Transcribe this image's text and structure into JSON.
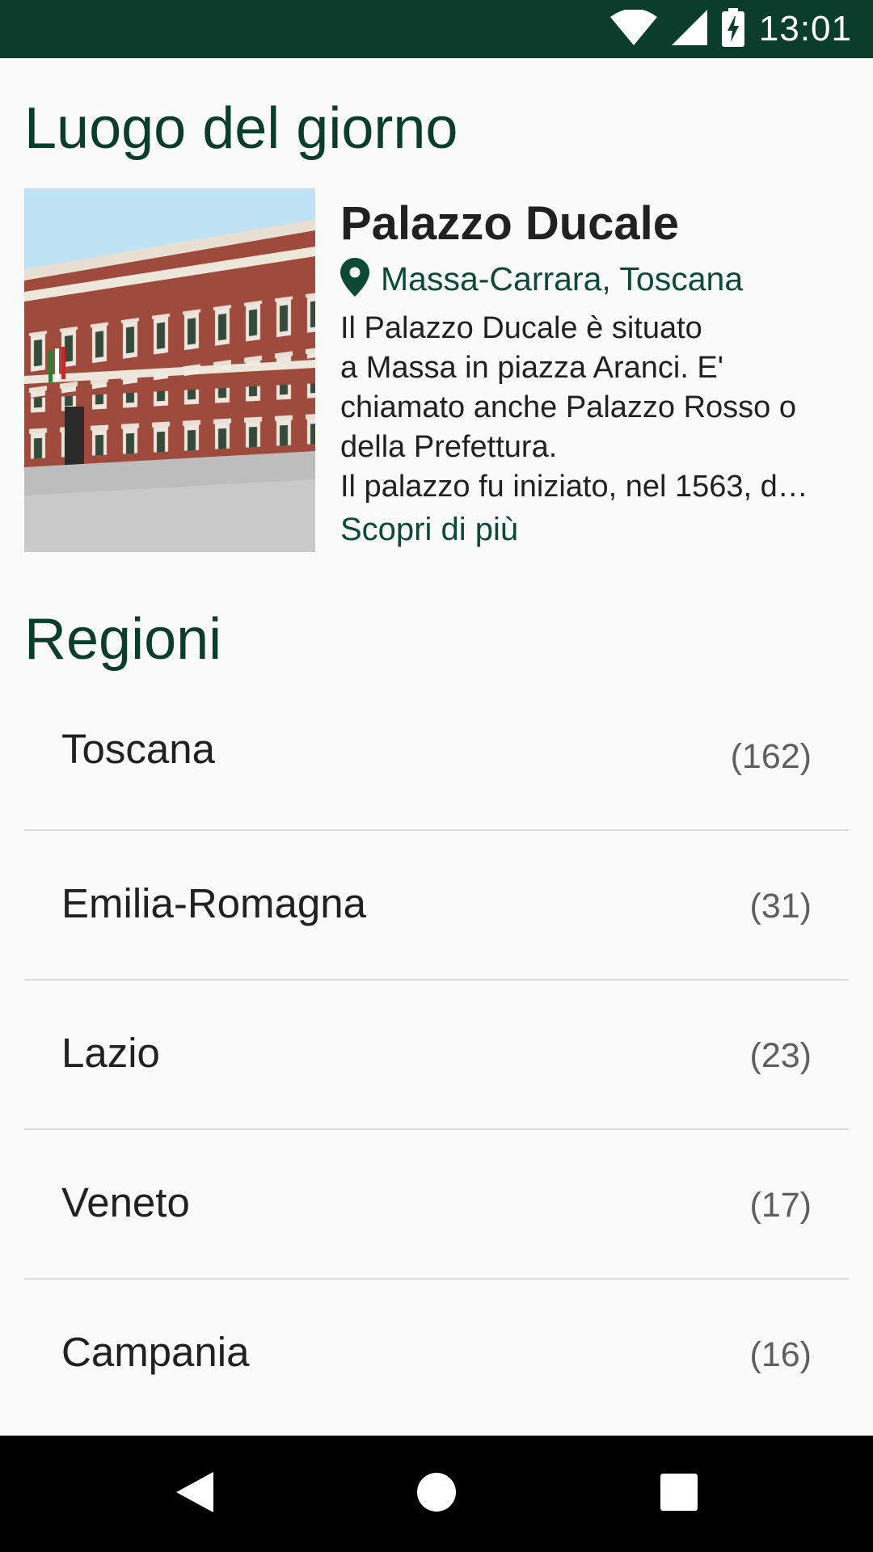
{
  "status_bar": {
    "time": "13:01",
    "icons": [
      "wifi-icon",
      "cell-signal-icon",
      "battery-charging-icon"
    ]
  },
  "place_of_day": {
    "section_title": "Luogo del giorno",
    "name": "Palazzo Ducale",
    "location_icon": "map-pin-icon",
    "location": "Massa-Carrara, Toscana",
    "description_lines": [
      "Il Palazzo Ducale è situato",
      "a Massa in piazza Aranci. E'",
      "chiamato anche Palazzo Rosso o",
      "della Prefettura.",
      "Il palazzo fu iniziato, nel 1563, d…"
    ],
    "more_link": "Scopri di più"
  },
  "regions": {
    "section_title": "Regioni",
    "items": [
      {
        "name": "Toscana",
        "count": "(162)"
      },
      {
        "name": "Emilia-Romagna",
        "count": "(31)"
      },
      {
        "name": "Lazio",
        "count": "(23)"
      },
      {
        "name": "Veneto",
        "count": "(17)"
      },
      {
        "name": "Campania",
        "count": "(16)"
      }
    ]
  },
  "nav_bar": {
    "icons": [
      "back-icon",
      "home-icon",
      "recents-icon"
    ]
  },
  "colors": {
    "primary_dark": "#0B3D2C",
    "accent_green": "#0B4A35",
    "background": "#FAFAFA",
    "text_primary": "#212121",
    "divider": "#D9D9D9"
  }
}
